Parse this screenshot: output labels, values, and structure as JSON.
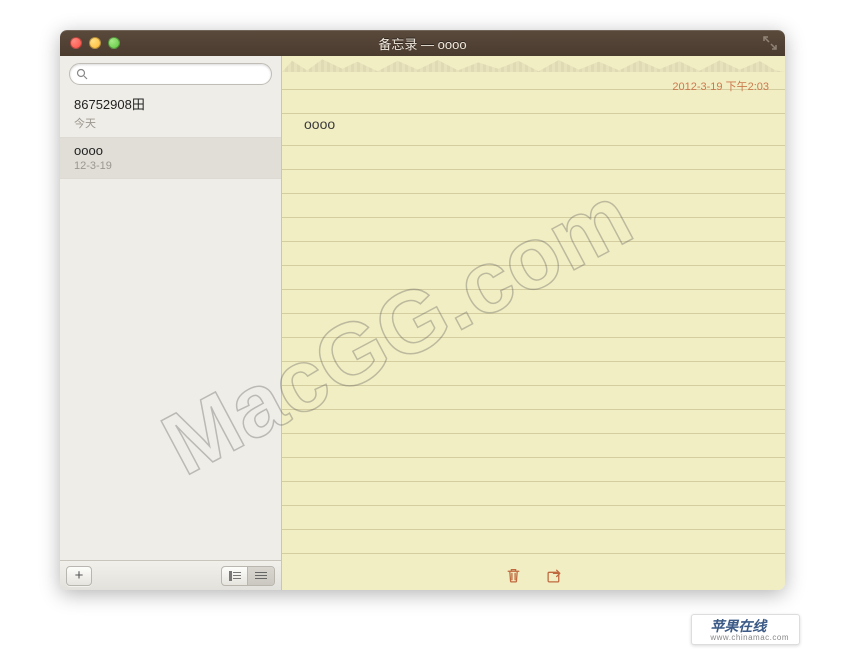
{
  "window": {
    "title": "备忘录 — oooo"
  },
  "sidebar": {
    "search_placeholder": "",
    "notes": [
      {
        "title": "86752908田",
        "date": "今天",
        "selected": false
      },
      {
        "title": "oooo",
        "date": "12-3-19",
        "selected": true
      }
    ],
    "add_label": "+"
  },
  "content": {
    "timestamp": "2012-3-19 下午2:03",
    "body": "oooo"
  },
  "watermark": "MacGG.com",
  "badge": {
    "main": "苹果在线",
    "sub": "www.chinamac.com"
  }
}
